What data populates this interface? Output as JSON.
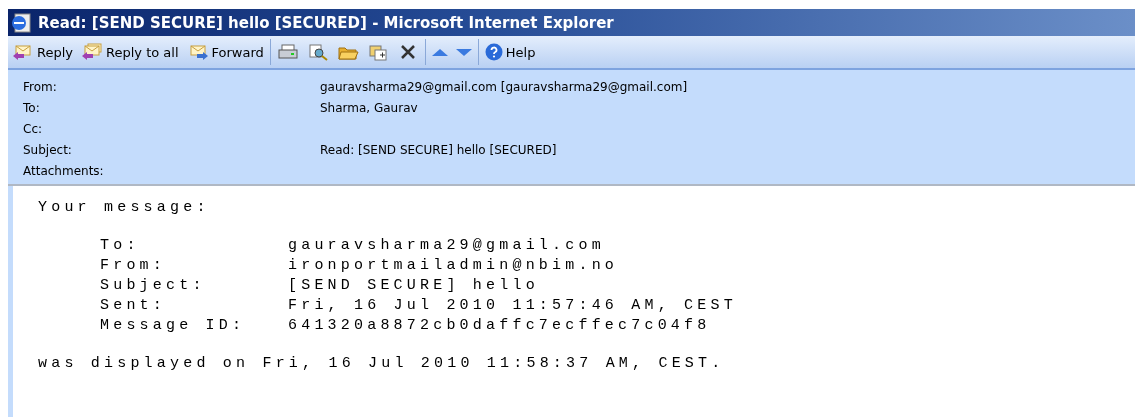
{
  "window": {
    "title": "Read: [SEND SECURE] hello [SECURED] - Microsoft Internet Explorer"
  },
  "toolbar": [
    {
      "kind": "reply",
      "label": "Reply"
    },
    {
      "kind": "reply-all",
      "label": "Reply to all"
    },
    {
      "kind": "forward",
      "label": "Forward"
    },
    {
      "kind": "separator"
    },
    {
      "kind": "print"
    },
    {
      "kind": "find"
    },
    {
      "kind": "move"
    },
    {
      "kind": "copy"
    },
    {
      "kind": "delete"
    },
    {
      "kind": "separator"
    },
    {
      "kind": "up"
    },
    {
      "kind": "down"
    },
    {
      "kind": "separator"
    },
    {
      "kind": "help",
      "label": "Help"
    }
  ],
  "header": [
    {
      "label": "From:",
      "value": "gauravsharma29@gmail.com [gauravsharma29@gmail.com]"
    },
    {
      "label": "To:",
      "value": "Sharma, Gaurav"
    },
    {
      "label": "Cc:"
    },
    {
      "label": "Subject:",
      "value": "Read: [SEND SECURE] hello [SECURED]"
    },
    {
      "label": "Attachments:"
    }
  ],
  "body": {
    "intro": "Your message:",
    "fields": [
      {
        "label": "To:",
        "value": "gauravsharma29@gmail.com"
      },
      {
        "label": "From:",
        "value": "ironportmailadmin@nbim.no"
      },
      {
        "label": "Subject:",
        "value": "[SEND SECURE] hello"
      },
      {
        "label": "Sent:",
        "value": "Fri, 16 Jul 2010 11:57:46 AM, CEST"
      },
      {
        "label": "Message ID:",
        "value": "641320a8872cb0daffc7ecffec7c04f8"
      }
    ],
    "footer": "was displayed on Fri, 16 Jul 2010 11:58:37 AM, CEST."
  }
}
